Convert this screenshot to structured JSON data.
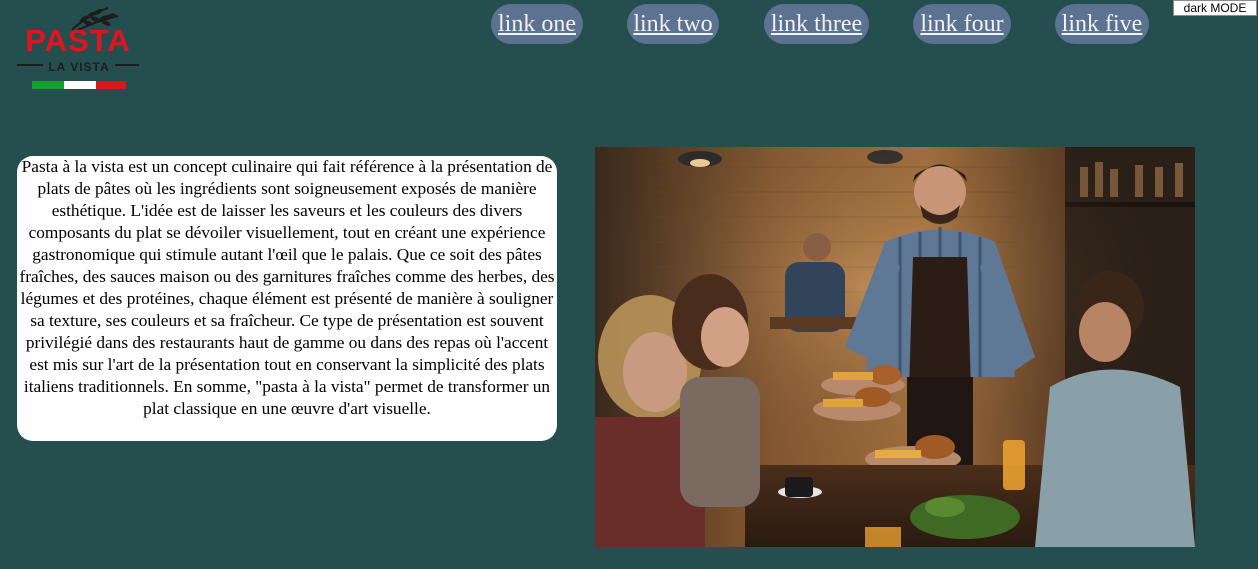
{
  "logo": {
    "main": "PASTA",
    "sub": "LA VISTA"
  },
  "nav": {
    "links": [
      {
        "label": "link one"
      },
      {
        "label": "link two"
      },
      {
        "label": "link three"
      },
      {
        "label": "link four"
      },
      {
        "label": "link five"
      }
    ]
  },
  "dark_mode_button": {
    "label": "dark MODE"
  },
  "intro": {
    "text": "Pasta à la vista est un concept culinaire qui fait référence à la présentation de plats de pâtes où les ingrédients sont soigneusement exposés de manière esthétique. L'idée est de laisser les saveurs et les couleurs des divers composants du plat se dévoiler visuellement, tout en créant une expérience gastronomique qui stimule autant l'œil que le palais. Que ce soit des pâtes fraîches, des sauces maison ou des garnitures fraîches comme des herbes, des légumes et des protéines, chaque élément est présenté de manière à souligner sa texture, ses couleurs et sa fraîcheur. Ce type de présentation est souvent privilégié dans des restaurants haut de gamme ou dans des repas où l'accent est mis sur l'art de la présentation tout en conservant la simplicité des plats italiens traditionnels. En somme, \"pasta à la vista\" permet de transformer un plat classique en une œuvre d'art visuelle."
  },
  "colors": {
    "background": "#254f4f",
    "nav_pill": "#5b7291",
    "logo_red": "#e0141e",
    "flag_green": "#14a02a"
  }
}
